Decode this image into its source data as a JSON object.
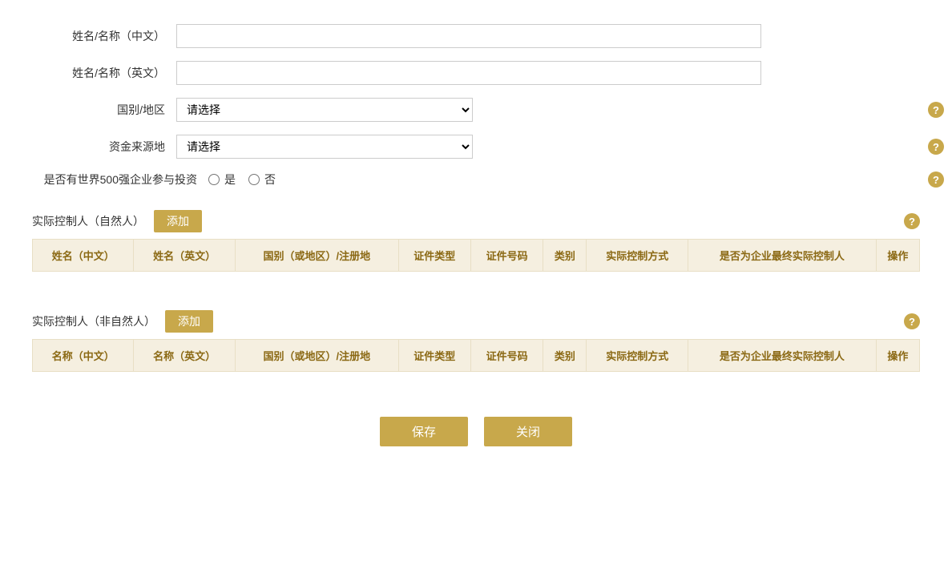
{
  "form": {
    "name_cn_label": "姓名/名称（中文）",
    "name_en_label": "姓名/名称（英文）",
    "country_label": "国别/地区",
    "country_placeholder": "请选择",
    "fund_source_label": "资金来源地",
    "fund_source_placeholder": "请选择",
    "fortune500_label": "是否有世界500强企业参与投资",
    "radio_yes": "是",
    "radio_no": "否"
  },
  "section1": {
    "title": "实际控制人（自然人）",
    "add_label": "添加",
    "help": "?",
    "columns": [
      "姓名（中文）",
      "姓名（英文）",
      "国别（或地区）/注册地",
      "证件类型",
      "证件号码",
      "类别",
      "实际控制方式",
      "是否为企业最终实际控制人",
      "操作"
    ]
  },
  "section2": {
    "title": "实际控制人（非自然人）",
    "add_label": "添加",
    "help": "?",
    "columns": [
      "名称（中文）",
      "名称（英文）",
      "国别（或地区）/注册地",
      "证件类型",
      "证件号码",
      "类别",
      "实际控制方式",
      "是否为企业最终实际控制人",
      "操作"
    ]
  },
  "buttons": {
    "save": "保存",
    "close": "关闭"
  },
  "help_icon": "?"
}
